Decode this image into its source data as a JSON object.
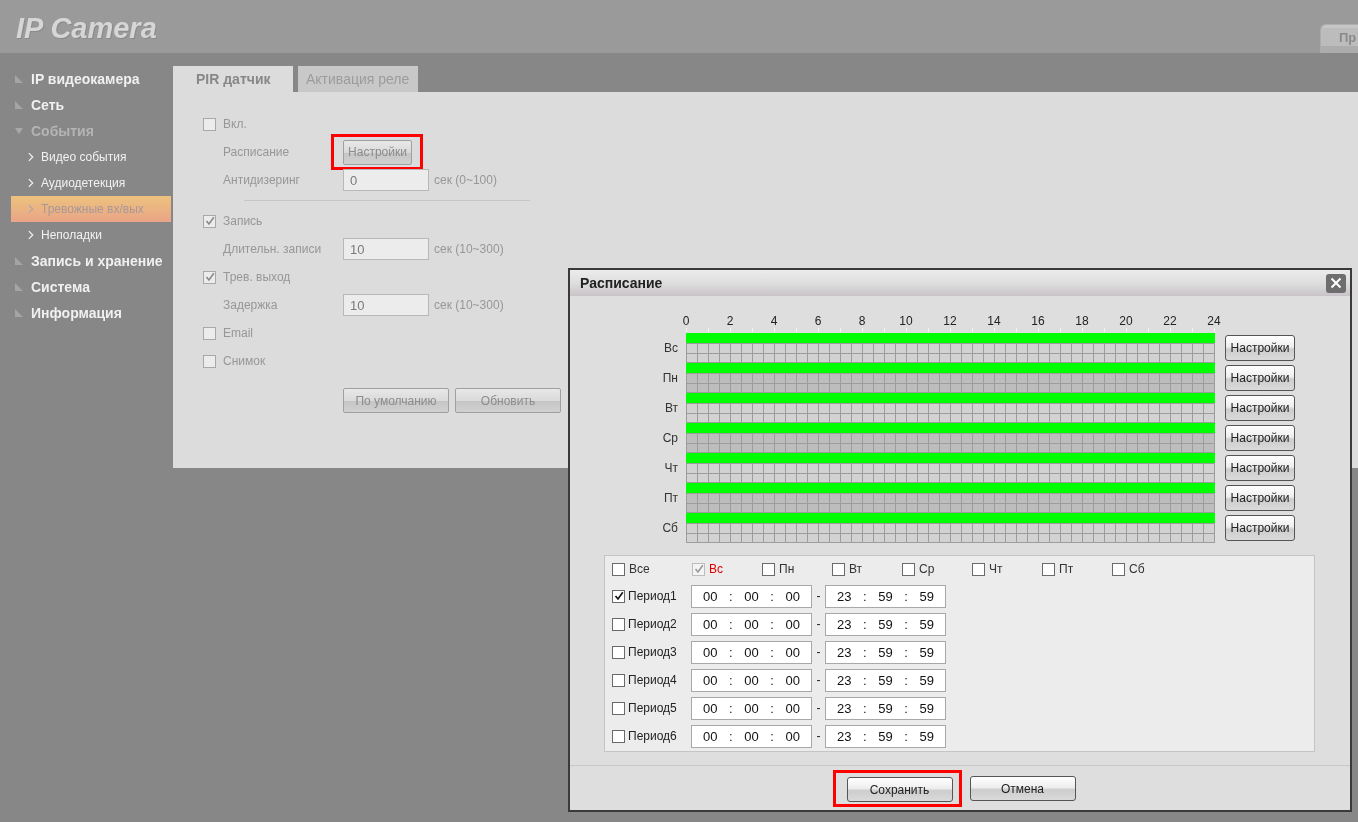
{
  "header": {
    "logo": "IP Camera",
    "top_tab": "Пр"
  },
  "sidebar": {
    "items": [
      {
        "label": "IP видеокамера",
        "expanded": false
      },
      {
        "label": "Сеть",
        "expanded": false
      },
      {
        "label": "События",
        "expanded": true,
        "children": [
          {
            "label": "Видео события",
            "selected": false
          },
          {
            "label": "Аудиодетекция",
            "selected": false
          },
          {
            "label": "Тревожные вх/вых",
            "selected": true
          },
          {
            "label": "Неполадки",
            "selected": false
          }
        ]
      },
      {
        "label": "Запись и хранение",
        "expanded": false
      },
      {
        "label": "Система",
        "expanded": false
      },
      {
        "label": "Информация",
        "expanded": false
      }
    ]
  },
  "tabs": [
    {
      "label": "PIR датчик",
      "selected": true
    },
    {
      "label": "Активация реле",
      "selected": false
    }
  ],
  "form": {
    "rows": [
      {
        "kind": "checkbox",
        "label": "Вкл.",
        "checked": false
      },
      {
        "kind": "button",
        "label": "Расписание",
        "button": "Настройки",
        "highlighted": true
      },
      {
        "kind": "input",
        "label": "Антидизеринг",
        "value": "0",
        "unit": "сек (0~100)"
      },
      {
        "kind": "divider"
      },
      {
        "kind": "checkbox",
        "label": "Запись",
        "checked": true
      },
      {
        "kind": "input",
        "label": "Длительн. записи",
        "value": "10",
        "unit": "сек (10~300)"
      },
      {
        "kind": "checkbox",
        "label": "Трев. выход",
        "checked": true
      },
      {
        "kind": "input",
        "label": "Задержка",
        "value": "10",
        "unit": "сек (10~300)"
      },
      {
        "kind": "checkbox",
        "label": "Email",
        "checked": false
      },
      {
        "kind": "checkbox",
        "label": "Снимок",
        "checked": false
      }
    ],
    "buttons": [
      "По умолчанию",
      "Обновить"
    ]
  },
  "dialog": {
    "title": "Расписание",
    "hours": [
      "0",
      "2",
      "4",
      "6",
      "8",
      "10",
      "12",
      "14",
      "16",
      "18",
      "20",
      "22",
      "24"
    ],
    "days": [
      {
        "label": "Вс",
        "level": 1,
        "button": "Настройки"
      },
      {
        "label": "Пн",
        "level": 1,
        "button": "Настройки"
      },
      {
        "label": "Вт",
        "level": 1,
        "button": "Настройки"
      },
      {
        "label": "Ср",
        "level": 1,
        "button": "Настройки"
      },
      {
        "label": "Чт",
        "level": 1,
        "button": "Настройки"
      },
      {
        "label": "Пт",
        "level": 1,
        "button": "Настройки"
      },
      {
        "label": "Сб",
        "level": 1,
        "button": "Настройки"
      }
    ],
    "day_checks": [
      {
        "label": "Все",
        "checked": false,
        "disabled": false,
        "selected": false
      },
      {
        "label": "Вс",
        "checked": true,
        "disabled": true,
        "selected": true
      },
      {
        "label": "Пн",
        "checked": false,
        "disabled": false,
        "selected": false
      },
      {
        "label": "Вт",
        "checked": false,
        "disabled": false,
        "selected": false
      },
      {
        "label": "Ср",
        "checked": false,
        "disabled": false,
        "selected": false
      },
      {
        "label": "Чт",
        "checked": false,
        "disabled": false,
        "selected": false
      },
      {
        "label": "Пт",
        "checked": false,
        "disabled": false,
        "selected": false
      },
      {
        "label": "Сб",
        "checked": false,
        "disabled": false,
        "selected": false
      }
    ],
    "periods": [
      {
        "label": "Период1",
        "checked": true,
        "start": "00 : 00 : 00",
        "separator": "-",
        "end": "23 : 59 : 59"
      },
      {
        "label": "Период2",
        "checked": false,
        "start": "00 : 00 : 00",
        "separator": "-",
        "end": "23 : 59 : 59"
      },
      {
        "label": "Период3",
        "checked": false,
        "start": "00 : 00 : 00",
        "separator": "-",
        "end": "23 : 59 : 59"
      },
      {
        "label": "Период4",
        "checked": false,
        "start": "00 : 00 : 00",
        "separator": "-",
        "end": "23 : 59 : 59"
      },
      {
        "label": "Период5",
        "checked": false,
        "start": "00 : 00 : 00",
        "separator": "-",
        "end": "23 : 59 : 59"
      },
      {
        "label": "Период6",
        "checked": false,
        "start": "00 : 00 : 00",
        "separator": "-",
        "end": "23 : 59 : 59"
      }
    ],
    "buttons": [
      {
        "label": "Сохранить",
        "highlighted": true
      },
      {
        "label": "Отмена",
        "highlighted": false
      }
    ]
  }
}
